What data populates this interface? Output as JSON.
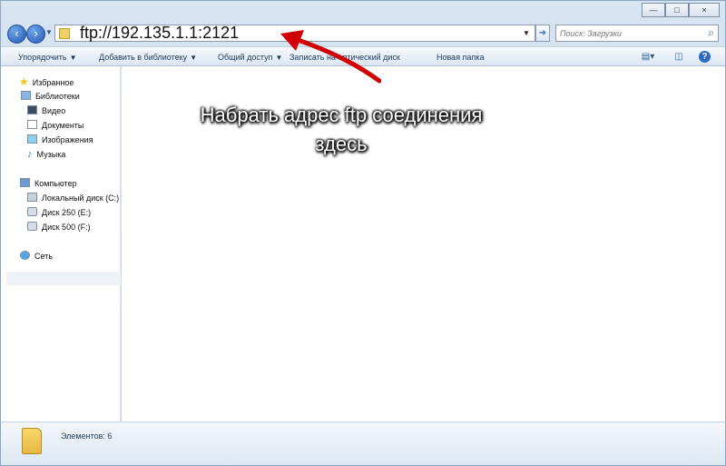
{
  "window": {
    "minimize_symbol": "—",
    "maximize_symbol": "□",
    "close_symbol": "×"
  },
  "address_bar": {
    "value": "ftp://192.135.1.1:2121",
    "go_symbol": "➜"
  },
  "navigation": {
    "back_symbol": "‹",
    "forward_symbol": "›",
    "dropdown_symbol": "▼"
  },
  "search": {
    "placeholder": "Поиск: Загрузки",
    "icon": "search-icon"
  },
  "toolbar": {
    "items": [
      {
        "label": "Упорядочить",
        "arrow": "▼"
      },
      {
        "label": "Добавить в библиотеку",
        "arrow": "▼"
      },
      {
        "label": "Общий доступ",
        "arrow": "▼"
      },
      {
        "label": "Записать на оптический диск"
      },
      {
        "label": "Новая папка"
      }
    ],
    "view_icon": "view-icon",
    "preview_icon": "preview-pane-icon",
    "help_label": "?"
  },
  "sidebar": {
    "favorites": "Избранное",
    "libraries": "Библиотеки",
    "video": "Видео",
    "documents": "Документы",
    "images": "Изображения",
    "music": "Музыка",
    "computer": "Компьютер",
    "drive_c": "Локальный диск (C:)",
    "drive_e": "Диск 250 (E:)",
    "drive_f": "Диск 500 (F:)",
    "network": "Сеть"
  },
  "annotation": {
    "line1": "Набрать адрес ftp соединения",
    "line2": "здесь",
    "arrow_color": "#d10000"
  },
  "status": {
    "items": "Элементов: 6"
  },
  "colors": {
    "accent": "#2b6bc4",
    "toolbar": "#dbe6f3",
    "annotation_text": "#ffffff"
  }
}
